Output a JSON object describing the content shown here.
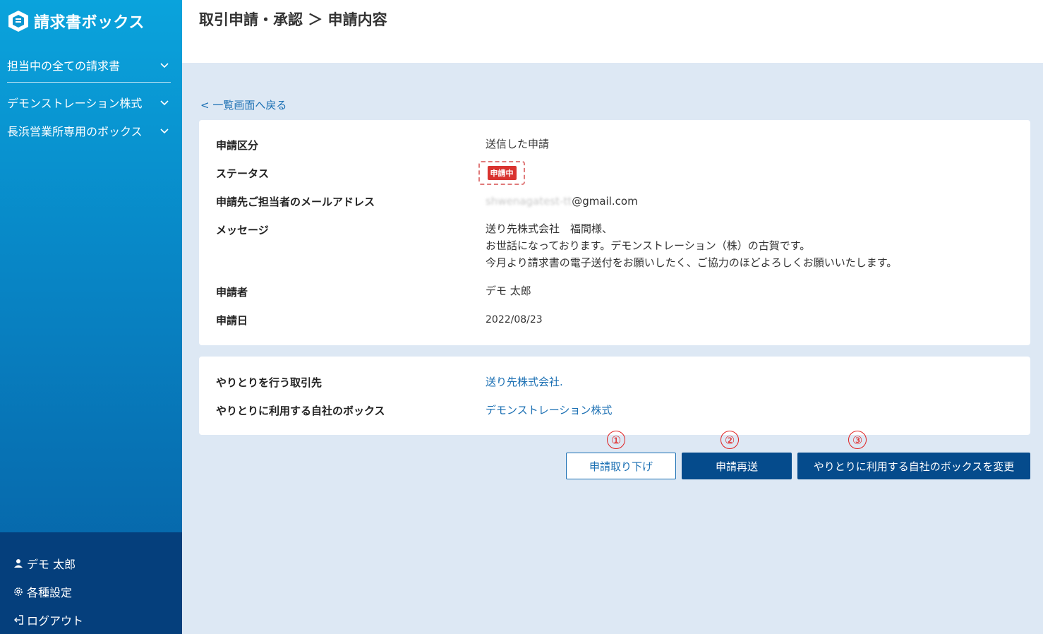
{
  "app": {
    "name": "請求書ボックス"
  },
  "sidebar": {
    "items": [
      {
        "label": "担当中の全ての請求書"
      },
      {
        "label": "デモンストレーション株式"
      },
      {
        "label": "長浜営業所専用のボックス"
      }
    ],
    "bottom": {
      "user": "デモ 太郎",
      "settings": "各種設定",
      "logout": "ログアウト"
    }
  },
  "header": {
    "title": "取引申請・承認 ＞ 申請内容"
  },
  "main": {
    "back_link": "< 一覧画面へ戻る",
    "details": {
      "type_label": "申請区分",
      "type_value": "送信した申請",
      "status_label": "ステータス",
      "status_value": "申請中",
      "email_label": "申請先ご担当者のメールアドレス",
      "email_value_masked": "shwenagatest-tt",
      "email_value_domain": "@gmail.com",
      "message_label": "メッセージ",
      "message_lines": [
        "送り先株式会社　福間様、",
        "お世話になっております。デモンストレーション（株）の古賀です。",
        "今月より請求書の電子送付をお願いしたく、ご協力のほどよろしくお願いいたします。"
      ],
      "applicant_label": "申請者",
      "applicant_value": "デモ 太郎",
      "date_label": "申請日",
      "date_value": "2022/08/23"
    },
    "partner": {
      "partner_label": "やりとりを行う取引先",
      "partner_value": "送り先株式会社.",
      "box_label": "やりとりに利用する自社のボックス",
      "box_value": "デモンストレーション株式"
    },
    "buttons": {
      "withdraw": "申請取り下げ",
      "resend": "申請再送",
      "change_box": "やりとりに利用する自社のボックスを変更"
    },
    "annotations": [
      "①",
      "②",
      "③"
    ]
  },
  "colors": {
    "sidebar_top": "#0aa3dc",
    "sidebar_bottom": "#053f7c",
    "accent": "#054b8c",
    "link": "#1a6fb3",
    "status_badge": "#d9332f",
    "background": "#dde8f4"
  }
}
